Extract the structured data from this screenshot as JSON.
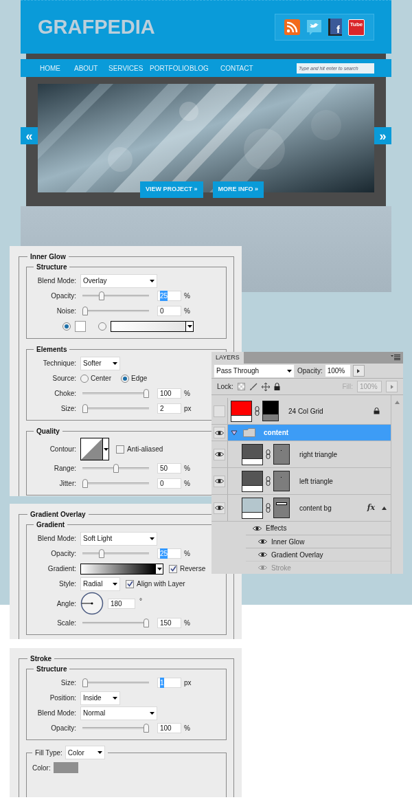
{
  "website": {
    "logo": "GRAFPEDIA",
    "social": [
      {
        "kind": "rss"
      },
      {
        "kind": "bird"
      },
      {
        "kind": "book",
        "text": "f"
      },
      {
        "kind": "tv",
        "text": "Tube"
      }
    ],
    "nav": [
      {
        "label": "HOME"
      },
      {
        "label": "ABOUT"
      },
      {
        "label": "SERVICES"
      },
      {
        "label": "PORTFOLIO"
      },
      {
        "label": "BLOG"
      },
      {
        "label": "CONTACT"
      }
    ],
    "search": {
      "placeholder": "Type and hit enter to search"
    },
    "slider": {
      "prev": "«",
      "next": "»",
      "buttons": [
        "VIEW PROJECT »",
        "MORE INFO »"
      ]
    }
  },
  "panels": [
    {
      "title": "Inner Glow",
      "groups": [
        {
          "title": "Structure",
          "rows": [
            {
              "kind": "select",
              "label": "Blend Mode:",
              "value": "Overlay"
            },
            {
              "kind": "slider",
              "label": "Opacity:",
              "level": 0.27,
              "value": "25",
              "unit": "%",
              "highlighted": true
            },
            {
              "kind": "slider",
              "label": "Noise:",
              "level": 0,
              "value": "0",
              "unit": "%",
              "highlighted": false
            },
            {
              "kind": "fill",
              "options": [
                {
                  "kind": "swatch",
                  "selected": true
                },
                {
                  "kind": "gradient",
                  "selected": false
                }
              ]
            }
          ]
        },
        {
          "title": "Elements",
          "rows": [
            {
              "kind": "small_select",
              "label": "Technique:",
              "value": "Softer"
            },
            {
              "kind": "radio",
              "label": "Source:",
              "options": [
                {
                  "label": "Center",
                  "selected": false
                },
                {
                  "label": "Edge",
                  "selected": true
                }
              ]
            },
            {
              "kind": "slider",
              "label": "Choke:",
              "level": 1,
              "value": "100",
              "unit": "%",
              "highlighted": false
            },
            {
              "kind": "slider",
              "label": "Size:",
              "level": 0,
              "value": "2",
              "unit": "px",
              "highlighted": false
            }
          ]
        },
        {
          "title": "Quality",
          "rows": [
            {
              "kind": "contour",
              "label": "Contour:",
              "check": {
                "label": "Anti-aliased",
                "checked": false
              }
            },
            {
              "kind": "slider",
              "label": "Range:",
              "level": 0.5,
              "value": "50",
              "unit": "%",
              "highlighted": false
            },
            {
              "kind": "slider",
              "label": "Jitter:",
              "level": 0,
              "value": "0",
              "unit": "%",
              "highlighted": false
            }
          ]
        }
      ]
    },
    {
      "title": "Gradient Overlay",
      "groups": [
        {
          "title": "Gradient",
          "rows": [
            {
              "kind": "select",
              "label": "Blend Mode:",
              "value": "Soft Light"
            },
            {
              "kind": "slider",
              "label": "Opacity:",
              "level": 0.27,
              "value": "25",
              "unit": "%",
              "highlighted": true
            },
            {
              "kind": "gradient",
              "label": "Gradient:",
              "check": {
                "label": "Reverse",
                "checked": true
              }
            },
            {
              "kind": "small_select",
              "label": "Style:",
              "value": "Radial",
              "check": {
                "label": "Align with Layer",
                "checked": true
              }
            },
            {
              "kind": "angle",
              "label": "Angle:",
              "value": "180",
              "unit": "°"
            },
            {
              "kind": "slider",
              "label": "Scale:",
              "level": 1,
              "value": "150",
              "unit": "%",
              "highlighted": false
            }
          ]
        }
      ]
    },
    {
      "title": "Stroke",
      "groups": [
        {
          "title": "Structure",
          "rows": [
            {
              "kind": "slider",
              "label": "Size:",
              "level": 0,
              "value": "1",
              "unit": "px",
              "highlighted": true
            },
            {
              "kind": "small_select",
              "label": "Position:",
              "value": "Inside"
            },
            {
              "kind": "select",
              "label": "Blend Mode:",
              "value": "Normal"
            },
            {
              "kind": "slider",
              "label": "Opacity:",
              "level": 1,
              "value": "100",
              "unit": "%",
              "highlighted": false
            }
          ]
        },
        {
          "kind": "fill_type",
          "label": "Fill Type:",
          "value": "Color",
          "rows": [
            {
              "kind": "color",
              "label": "Color:",
              "color": "#8f8f8f"
            }
          ]
        }
      ]
    }
  ],
  "layers": {
    "tab": "LAYERS",
    "blend": "Pass Through",
    "opacity_label": "Opacity:",
    "opacity": "100%",
    "lock_label": "Lock:",
    "fill_label": "Fill:",
    "fill": "100%",
    "fill_disabled": true,
    "items": [
      {
        "kind": "layer",
        "name": "24 Col Grid",
        "visible": false,
        "color": "#ff0000",
        "mask": {
          "kind": "black"
        },
        "locked": true,
        "selected": false
      },
      {
        "kind": "group",
        "name": "content",
        "visible": true,
        "expanded": true,
        "selected": true,
        "children": [
          {
            "kind": "layer",
            "name": "right triangle",
            "visible": true,
            "color": "#555555",
            "mask": {
              "kind": "dot"
            },
            "locked": false,
            "selected": false
          },
          {
            "kind": "layer",
            "name": "left triangle",
            "visible": true,
            "color": "#555555",
            "mask": {
              "kind": "dot"
            },
            "locked": false,
            "selected": false
          },
          {
            "kind": "layer",
            "name": "content bg",
            "visible": true,
            "color": "#b4c6cd",
            "mask": {
              "kind": "bar"
            },
            "locked": false,
            "selected": false,
            "fx": "fx",
            "effects": {
              "label": "Effects",
              "visible": true,
              "children": [
                {
                  "name": "Inner Glow",
                  "visible": true,
                  "dimmed": false
                },
                {
                  "name": "Gradient Overlay",
                  "visible": true,
                  "dimmed": false
                },
                {
                  "name": "Stroke",
                  "visible": true,
                  "dimmed": true
                }
              ]
            }
          }
        ]
      }
    ]
  }
}
